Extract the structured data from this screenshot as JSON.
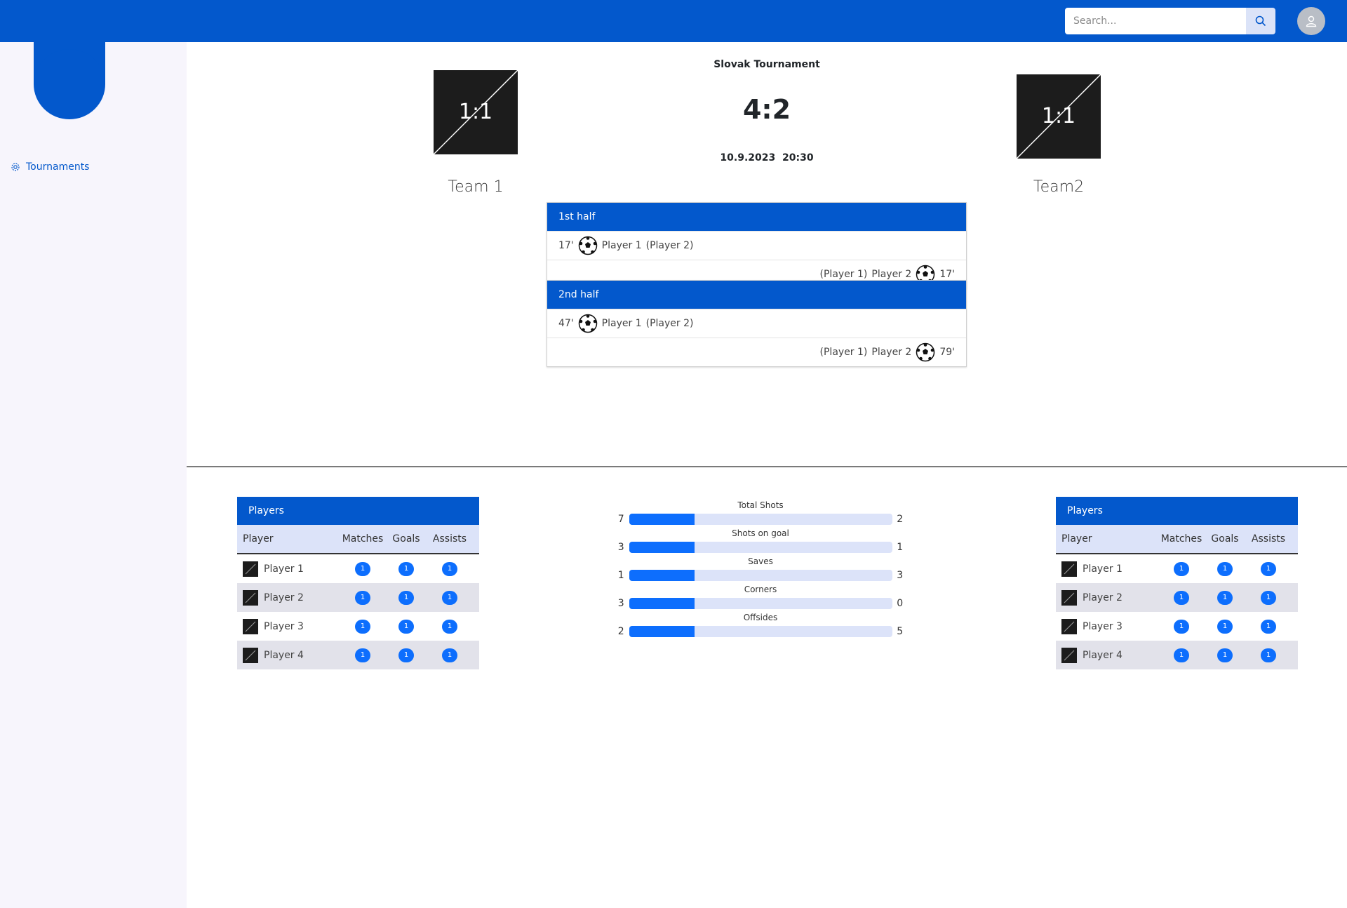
{
  "header": {
    "search_placeholder": "Search..."
  },
  "sidebar": {
    "items": [
      {
        "label": "Tournaments",
        "icon": "gear-icon"
      }
    ]
  },
  "match": {
    "tournament": "Slovak Tournament",
    "score": "4:2",
    "date": "10.9.2023",
    "time": "20:30",
    "home": {
      "name": "Team 1",
      "logo_text": "1:1"
    },
    "away": {
      "name": "Team2",
      "logo_text": "1:1"
    }
  },
  "halves": [
    {
      "title": "1st half",
      "events": [
        {
          "side": "home",
          "minute": "17'",
          "scorer": "Player 1",
          "assist": "(Player 2)"
        },
        {
          "side": "away",
          "minute": "17'",
          "scorer": "Player 2",
          "assist": "(Player 1)"
        }
      ]
    },
    {
      "title": "2nd half",
      "events": [
        {
          "side": "home",
          "minute": "47'",
          "scorer": "Player 1",
          "assist": "(Player 2)"
        },
        {
          "side": "away",
          "minute": "79'",
          "scorer": "Player 2",
          "assist": "(Player 1)"
        }
      ]
    }
  ],
  "players_table": {
    "title": "Players",
    "columns": [
      "Player",
      "Matches",
      "Goals",
      "Assists"
    ],
    "home_rows": [
      {
        "name": "Player 1",
        "matches": "1",
        "goals": "1",
        "assists": "1"
      },
      {
        "name": "Player 2",
        "matches": "1",
        "goals": "1",
        "assists": "1"
      },
      {
        "name": "Player 3",
        "matches": "1",
        "goals": "1",
        "assists": "1"
      },
      {
        "name": "Player 4",
        "matches": "1",
        "goals": "1",
        "assists": "1"
      }
    ],
    "away_rows": [
      {
        "name": "Player 1",
        "matches": "1",
        "goals": "1",
        "assists": "1"
      },
      {
        "name": "Player 2",
        "matches": "1",
        "goals": "1",
        "assists": "1"
      },
      {
        "name": "Player 3",
        "matches": "1",
        "goals": "1",
        "assists": "1"
      },
      {
        "name": "Player 4",
        "matches": "1",
        "goals": "1",
        "assists": "1"
      }
    ]
  },
  "stats": [
    {
      "label": "Total Shots",
      "home": "7",
      "away": "2",
      "fill": 0.25
    },
    {
      "label": "Shots on goal",
      "home": "3",
      "away": "1",
      "fill": 0.25
    },
    {
      "label": "Saves",
      "home": "1",
      "away": "3",
      "fill": 0.25
    },
    {
      "label": "Corners",
      "home": "3",
      "away": "0",
      "fill": 0.25
    },
    {
      "label": "Offsides",
      "home": "2",
      "away": "5",
      "fill": 0.25
    }
  ],
  "colors": {
    "primary": "#0358cc",
    "badge": "#0d6efd",
    "light": "#dce3f9"
  }
}
